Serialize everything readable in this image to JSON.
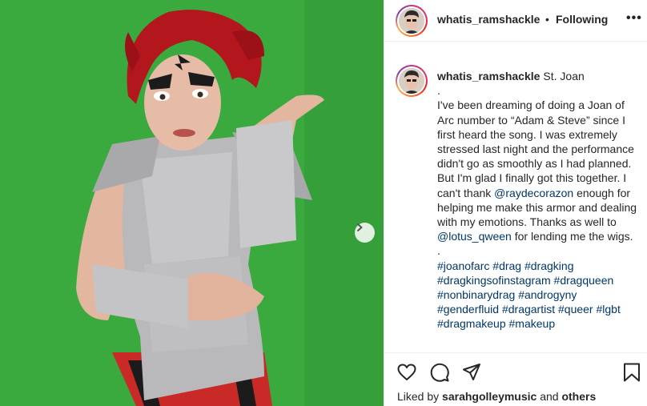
{
  "post": {
    "username": "whatis_ramshackle",
    "follow_separator": "•",
    "follow_state": "Following",
    "more_icon": "•••"
  },
  "caption": {
    "username": "whatis_ramshackle",
    "title": "St. Joan",
    "line_dot1": ".",
    "text1": "I've been dreaming of doing a Joan of Arc number to “Adam & Steve” since I first heard the song. I was extremely stressed last night and the performance didn't go as smoothly as I had planned. But I'm glad I finally got this together. I can't thank ",
    "mention1": "@raydecorazon",
    "text2": " enough for helping me make this armor and dealing with my emotions. Thanks as well to ",
    "mention2": "@lotus_qween",
    "text3": " for lending me the wigs.",
    "line_dot2": ".",
    "hashtags": [
      "#joanofarc",
      "#drag",
      "#dragking",
      "#dragkingsofinstagram",
      "#dragqueen",
      "#nonbinarydrag",
      "#androgyny",
      "#genderfluid",
      "#dragartist",
      "#queer",
      "#lgbt",
      "#dragmakeup",
      "#makeup"
    ]
  },
  "likes": {
    "prefix": "Liked by ",
    "user": "sarahgolleymusic",
    "middle": " and ",
    "others": "others"
  },
  "icons": {
    "like": "heart-icon",
    "comment": "comment-icon",
    "share": "share-icon",
    "save": "bookmark-icon",
    "next": "chevron-right-icon",
    "more": "more-icon"
  },
  "colors": {
    "background_green": "#3aa93e",
    "link": "#00376b",
    "text": "#262626",
    "border": "#efefef"
  }
}
